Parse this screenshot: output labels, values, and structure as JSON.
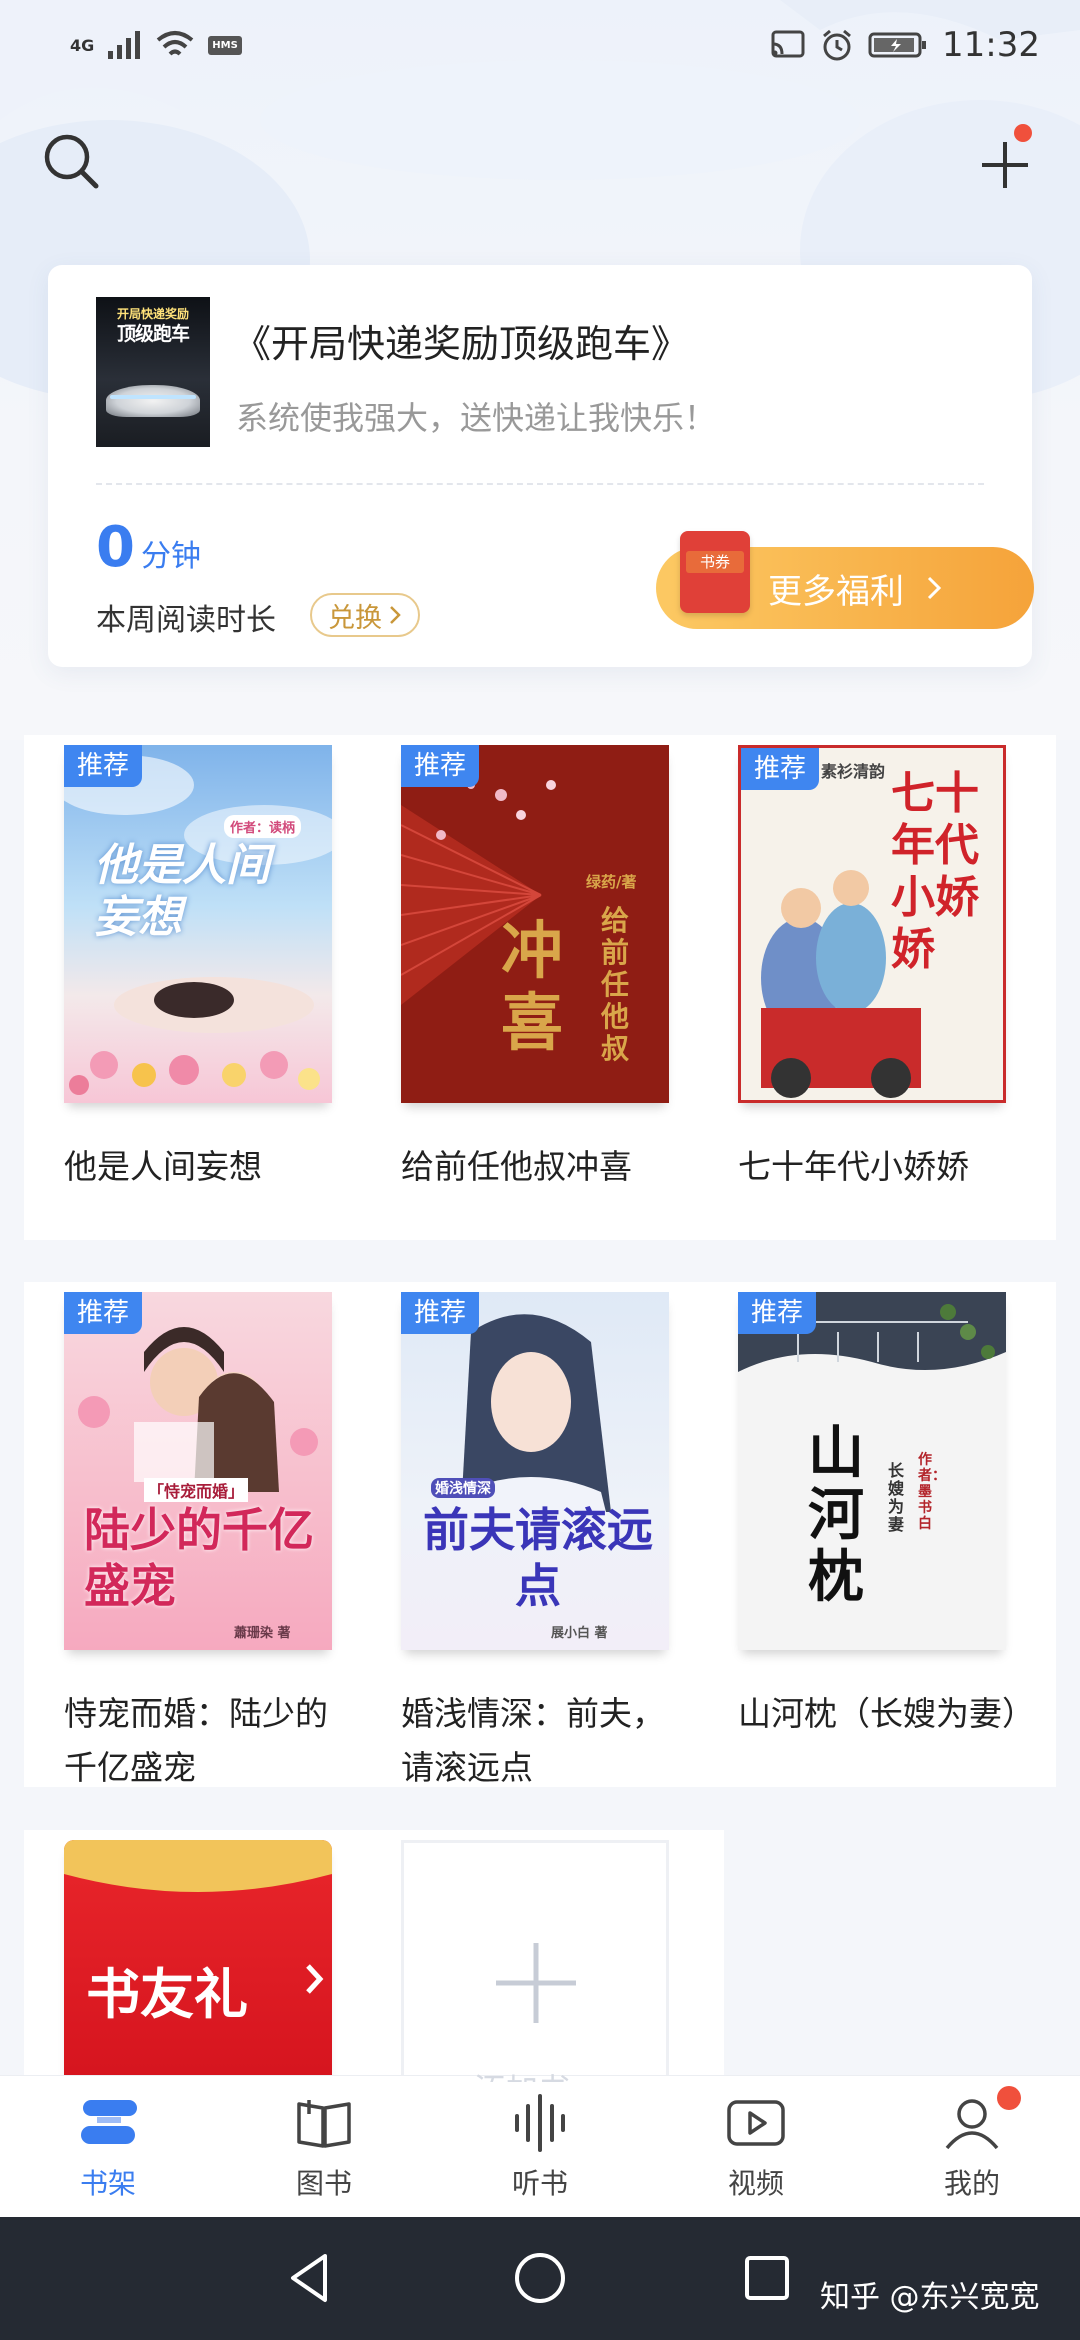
{
  "status_bar": {
    "network": "4G",
    "hms": "HMS",
    "time": "11:32"
  },
  "reading_card": {
    "book_cover_text": [
      "开局快递奖励",
      "顶级跑车"
    ],
    "book_title": "《开局快递奖励顶级跑车》",
    "book_subtitle": "系统使我强大，送快递让我快乐！",
    "minutes_value": "0",
    "minutes_unit": "分钟",
    "weekly_label": "本周阅读时长",
    "exchange_label": "兑换",
    "coupon_text": "书券",
    "welfare_label": "更多福利"
  },
  "shelf": {
    "tag_label": "推荐",
    "books": [
      {
        "title": "他是人间妄想",
        "cover_text": "他是人间妄想",
        "cover_note": "作者：读柄"
      },
      {
        "title": "给前任他叔冲喜",
        "cover_text": "冲喜",
        "cover_note": "给前任他叔",
        "cover_author": "绿药/著"
      },
      {
        "title": "七十年代小娇娇",
        "cover_text": "七十年代小娇娇",
        "cover_note": "素衫清韵"
      },
      {
        "title": "恃宠而婚：陆少的千亿盛宠",
        "cover_text": "陆少的千亿盛宠",
        "cover_note": "「恃宠而婚」",
        "cover_author": "蕭珊染 著"
      },
      {
        "title": "婚浅情深：前夫，请滚远点",
        "cover_text": "前夫请滚远点",
        "cover_note": "婚浅情深",
        "cover_author": "展小白 著"
      },
      {
        "title": "山河枕（长嫂为妻）",
        "cover_text": "山河枕",
        "cover_note": "长嫂为妻",
        "cover_author": "作者：墨书白"
      }
    ],
    "gift_card_text": "书友礼",
    "add_card_text": "添加书"
  },
  "bottom_nav": [
    {
      "label": "书架",
      "icon": "bookshelf-icon",
      "active": true
    },
    {
      "label": "图书",
      "icon": "book-icon",
      "active": false
    },
    {
      "label": "听书",
      "icon": "audio-icon",
      "active": false
    },
    {
      "label": "视频",
      "icon": "video-icon",
      "active": false
    },
    {
      "label": "我的",
      "icon": "profile-icon",
      "active": false
    }
  ],
  "watermark": "知乎 @东兴宽宽",
  "colors": {
    "accent": "#3a7df0",
    "tag_blue": "#3f86f0",
    "welfare_orange": "#f5a33a",
    "badge_red": "#f0503c",
    "system_nav": "#252a33"
  }
}
